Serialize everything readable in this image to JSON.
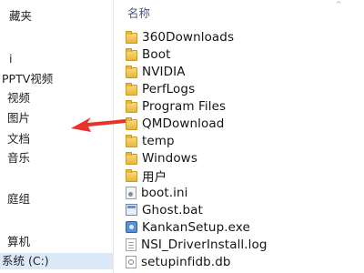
{
  "nav": {
    "items": [
      {
        "label": "藏夹"
      },
      {
        "label": "i"
      },
      {
        "label": "PPTV视频"
      },
      {
        "label": "视频"
      },
      {
        "label": "图片"
      },
      {
        "label": "文档"
      },
      {
        "label": "音乐"
      },
      {
        "label": "庭组"
      },
      {
        "label": "算机"
      },
      {
        "label": "系统 (C:)"
      }
    ]
  },
  "file_list": {
    "column_header": "名称",
    "sort_indicator": "^",
    "rows": [
      {
        "name": "360Downloads",
        "icon": "folder-icon"
      },
      {
        "name": "Boot",
        "icon": "folder-icon"
      },
      {
        "name": "NVIDIA",
        "icon": "folder-icon"
      },
      {
        "name": "PerfLogs",
        "icon": "folder-icon"
      },
      {
        "name": "Program Files",
        "icon": "folder-icon"
      },
      {
        "name": "QMDownload",
        "icon": "folder-icon"
      },
      {
        "name": "temp",
        "icon": "folder-icon"
      },
      {
        "name": "Windows",
        "icon": "folder-icon"
      },
      {
        "name": "用户",
        "icon": "folder-icon"
      },
      {
        "name": "boot.ini",
        "icon": "config-file-icon"
      },
      {
        "name": "Ghost.bat",
        "icon": "batch-file-icon"
      },
      {
        "name": "KankanSetup.exe",
        "icon": "executable-icon"
      },
      {
        "name": "NSI_DriverInstall.log",
        "icon": "log-file-icon"
      },
      {
        "name": "setupinfidb.db",
        "icon": "database-file-icon"
      }
    ]
  },
  "annotation": {
    "arrow_color": "#e8322b",
    "arrow_target": "QMDownload"
  },
  "colors": {
    "selected_bg": "#dce9f8",
    "header_text": "#4a5a78"
  }
}
